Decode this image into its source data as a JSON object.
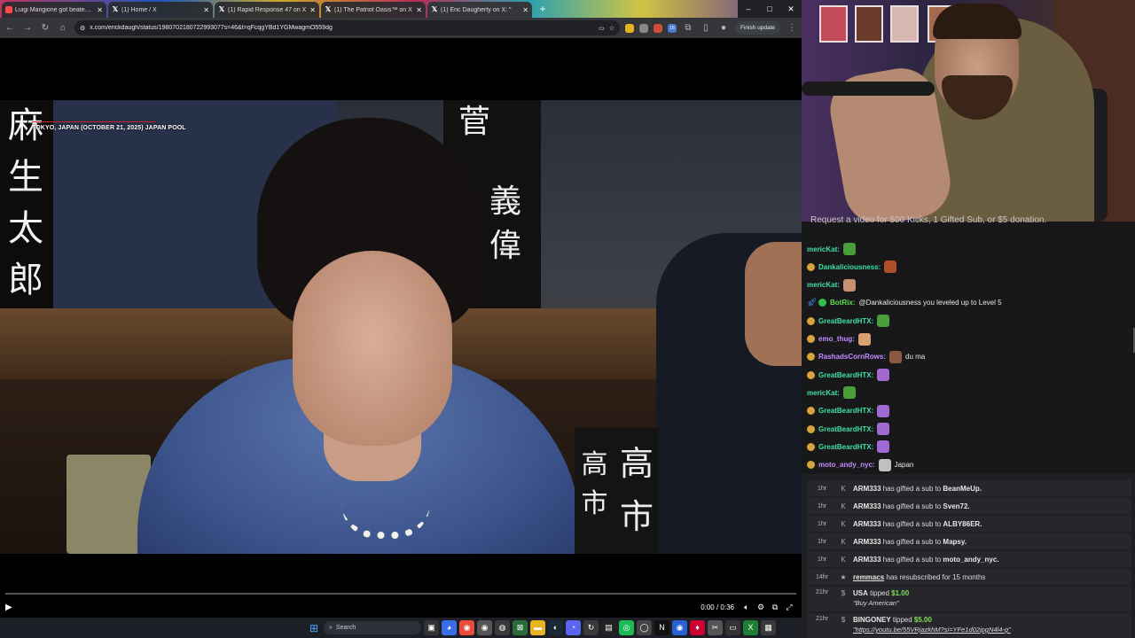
{
  "browser": {
    "tabs": [
      {
        "title": "Luigi Mangione got beaten up",
        "active": false
      },
      {
        "title": "(1) Home / X",
        "active": false
      },
      {
        "title": "(1) Rapid Response 47 on X",
        "active": false
      },
      {
        "title": "(1) The Patriot Oasis™ on X",
        "active": false
      },
      {
        "title": "(1) Eric Daugherty on X: \"",
        "active": true
      }
    ],
    "new_tab": "+",
    "window_controls": {
      "minimize": "–",
      "maximize": "□",
      "close": "✕"
    },
    "url": "x.com/erickdaugh/status/1980702180722993077s=46&t=qFcqgYBd1YGMwagmO559dg",
    "finish_update": "Finish update",
    "extension_badge": "16"
  },
  "video": {
    "caption": "TOKYO, JAPAN (OCTOBER 21, 2025) JAPAN POOL",
    "kanji_left": [
      "麻",
      "生",
      "太",
      "郎"
    ],
    "kanji_right_top": [
      "義",
      "偉"
    ],
    "kanji_right_top2": [
      "菅"
    ],
    "nameplate": [
      "高",
      "市",
      "高",
      "市"
    ],
    "progress": 0.0,
    "time": "0:00 / 0:36"
  },
  "taskbar": {
    "search_label": "Search"
  },
  "chat": {
    "banner": "Request a video for 500 Kicks, 1 Gifted Sub, or $5 donation.",
    "messages": [
      {
        "user": "mericKat:",
        "color": "#3ee0a0",
        "text": "",
        "badge": "none",
        "emote": "#4a9e3a"
      },
      {
        "user": "Dankaliciousness:",
        "color": "#3ee0a0",
        "text": "",
        "badge": "coin",
        "emote": "#b0502a"
      },
      {
        "user": "mericKat:",
        "color": "#3ee0a0",
        "text": "",
        "badge": "none",
        "emote": "#c99070"
      },
      {
        "user": "BotRix:",
        "color": "#59e04a",
        "text": "@Dankaliciousness you leveled up to Level 5",
        "badge": "bot",
        "emote": ""
      },
      {
        "user": "GreatBeardHTX:",
        "color": "#3ee0a0",
        "text": "",
        "badge": "coin",
        "emote": "#4a9e3a"
      },
      {
        "user": "emo_thug:",
        "color": "#c28cff",
        "text": "",
        "badge": "coin",
        "emote": "#d8a070"
      },
      {
        "user": "RashadsCornRows:",
        "color": "#c28cff",
        "text": "du ma",
        "badge": "coin",
        "emote": "#8a5a40"
      },
      {
        "user": "GreatBeardHTX:",
        "color": "#3ee0a0",
        "text": "",
        "badge": "coin",
        "emote": "#a06ad0"
      },
      {
        "user": "mericKat:",
        "color": "#3ee0a0",
        "text": "",
        "badge": "none",
        "emote": "#4a9e3a"
      },
      {
        "user": "GreatBeardHTX:",
        "color": "#3ee0a0",
        "text": "",
        "badge": "coin",
        "emote": "#a06ad0"
      },
      {
        "user": "GreatBeardHTX:",
        "color": "#3ee0a0",
        "text": "",
        "badge": "coin",
        "emote": "#a06ad0"
      },
      {
        "user": "GreatBeardHTX:",
        "color": "#3ee0a0",
        "text": "",
        "badge": "coin",
        "emote": "#a06ad0"
      },
      {
        "user": "moto_andy_nyc:",
        "color": "#c28cff",
        "text": "Japan",
        "badge": "coin",
        "emote": "#c0c0c0"
      }
    ]
  },
  "events": [
    {
      "time": "1hr",
      "user": "ARM333",
      "action": "has gifted a sub to",
      "target": "BeanMeUp.",
      "kind": "gift"
    },
    {
      "time": "1hr",
      "user": "ARM333",
      "action": "has gifted a sub to",
      "target": "Sven72.",
      "kind": "gift"
    },
    {
      "time": "1hr",
      "user": "ARM333",
      "action": "has gifted a sub to",
      "target": "ALBY86ER.",
      "kind": "gift"
    },
    {
      "time": "1hr",
      "user": "ARM333",
      "action": "has gifted a sub to",
      "target": "Mapsy.",
      "kind": "gift"
    },
    {
      "time": "1hr",
      "user": "ARM333",
      "action": "has gifted a sub to",
      "target": "moto_andy_nyc.",
      "kind": "gift"
    },
    {
      "time": "14hr",
      "user": "remmacs",
      "action": "has resubscribed for 15 months",
      "target": "",
      "kind": "resub"
    },
    {
      "time": "21hr",
      "user": "USA",
      "action": "tipped",
      "target": "$1.00",
      "kind": "tip",
      "note": "\"Buy American\""
    },
    {
      "time": "21hr",
      "user": "BINGONEY",
      "action": "tipped",
      "target": "$5.00",
      "kind": "tip",
      "note": "\"https://youtu.be/55VRjazkhM?si=YFe1d02ipgN4l4-g\""
    }
  ]
}
